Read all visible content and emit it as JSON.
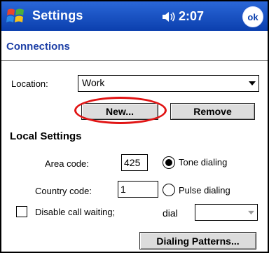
{
  "titlebar": {
    "title": "Settings",
    "time": "2:07",
    "ok_label": "ok"
  },
  "section": {
    "title": "Connections"
  },
  "location": {
    "label": "Location:",
    "value": "Work"
  },
  "buttons": {
    "new_label": "New...",
    "remove_label": "Remove",
    "patterns_label": "Dialing Patterns..."
  },
  "local": {
    "heading": "Local Settings",
    "area_code_label": "Area code:",
    "area_code_value": "425",
    "country_code_label": "Country code:",
    "country_code_value": "1",
    "tone_label": "Tone dialing",
    "pulse_label": "Pulse dialing",
    "selected_dialing": "Tone dialing",
    "disable_waiting_label": "Disable call waiting;",
    "disable_waiting_checked": false,
    "dial_label": "dial",
    "dial_value": ""
  },
  "colors": {
    "titlebar": "#0b3fae",
    "section_title": "#1d3fa6",
    "annotation": "#e11414"
  }
}
